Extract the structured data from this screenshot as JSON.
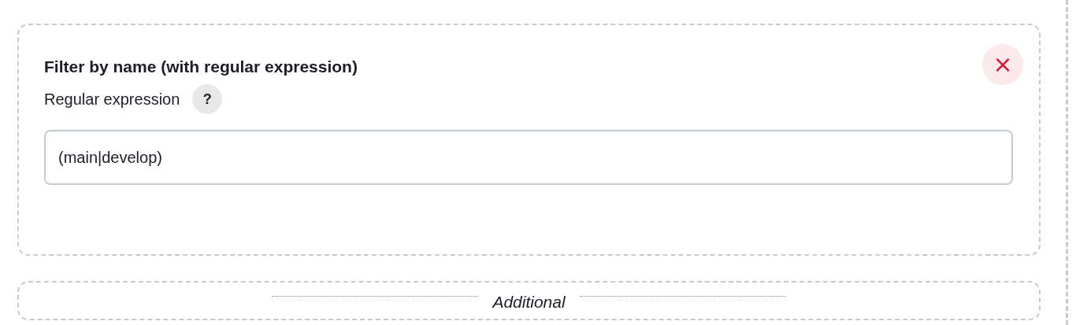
{
  "filter_card": {
    "title": "Filter by name (with regular expression)",
    "field_label": "Regular expression",
    "help_glyph": "?",
    "close_glyph": "×",
    "input": {
      "value": "(main|develop)"
    }
  },
  "additional_section": {
    "label": "Additional"
  }
}
